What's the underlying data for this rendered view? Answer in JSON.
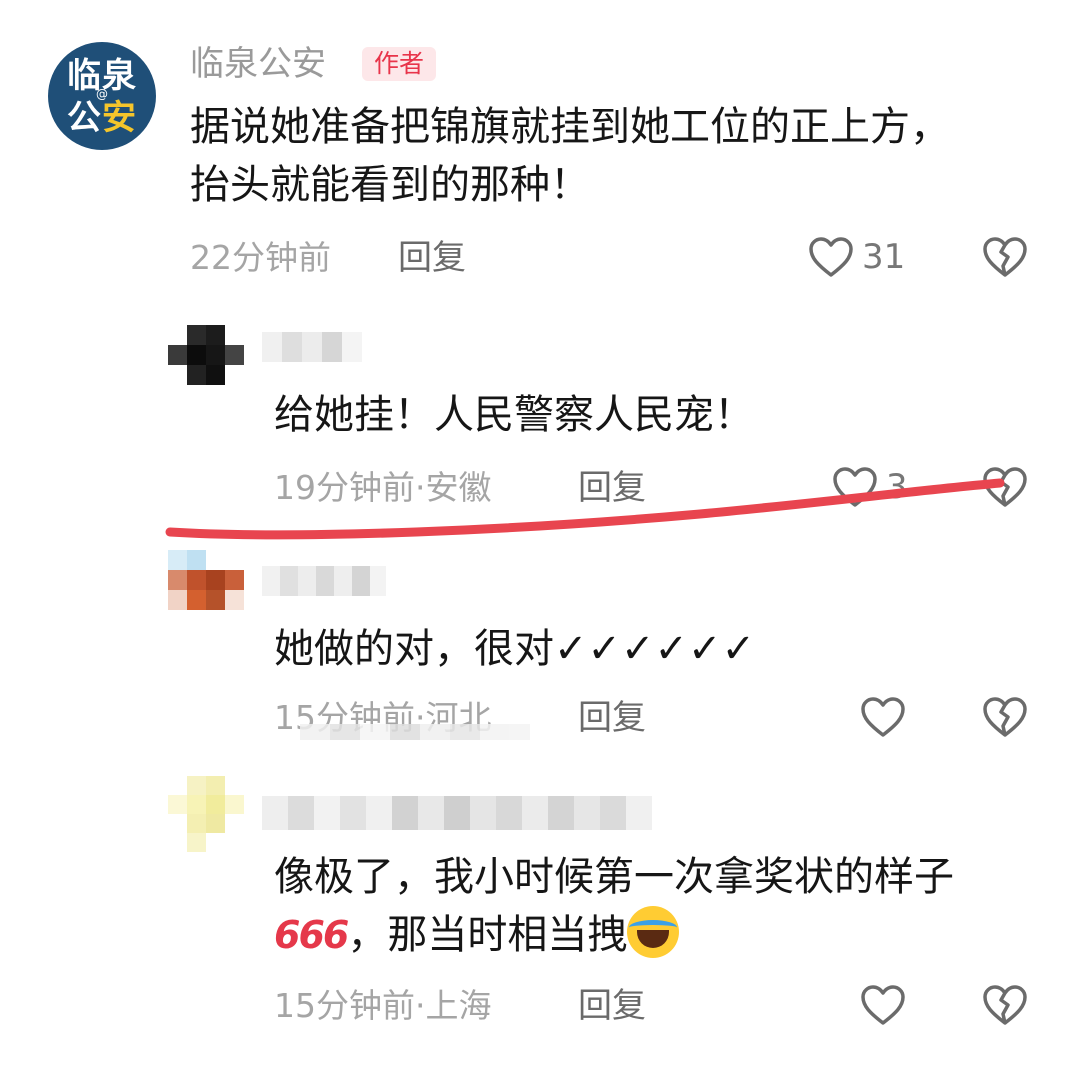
{
  "comments": [
    {
      "username": "临泉公安",
      "avatar_text_line1": "临泉",
      "avatar_text_line2_a": "公",
      "avatar_text_line2_b": "安",
      "avatar_at": "@",
      "badge": "作者",
      "text_line1": "据说她准备把锦旗就挂到她工位的正上方，",
      "text_line2": "抬头就能看到的那种！",
      "time": "22分钟前",
      "reply_label": "回复",
      "like_count": "31"
    },
    {
      "text": "给她挂！人民警察人民宠！",
      "time_location": "19分钟前·安徽",
      "reply_label": "回复",
      "like_count": "3"
    },
    {
      "text": "她做的对，很对✓✓✓✓✓✓",
      "time_location": "15分钟前·河北",
      "reply_label": "回复"
    },
    {
      "text_line1": "像极了，我小时候第一次拿奖状的样子",
      "emoji_666": "666",
      "text_line2": "，那当时相当拽",
      "time_location": "15分钟前·上海",
      "reply_label": "回复"
    }
  ],
  "colors": {
    "author_badge_bg": "#fde7e9",
    "author_badge_text": "#e8344a",
    "annotation_stroke": "#e8454f",
    "avatar_bg": "#1f4f78"
  },
  "icons": [
    "heart-outline-icon",
    "broken-heart-icon"
  ]
}
